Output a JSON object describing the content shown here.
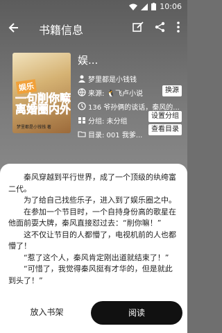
{
  "status": {
    "time": "10:06"
  },
  "appbar": {
    "title": "书籍信息"
  },
  "cover": {
    "tag": "娱乐",
    "title": "一句削你嘛 离婚圈内外",
    "sub": "梦里都是小钱钱 著"
  },
  "book": {
    "name": "娱...",
    "author": "梦里都是小钱钱",
    "source": "来源: 🐧飞卢小说",
    "summary": "136 爷孙俩的谈话，秦风的...",
    "group": "分组: 未分组",
    "toc": "目录: 001 我爹..."
  },
  "chips": {
    "switch_source": "换源",
    "set_group": "设置分组",
    "view_toc": "查看目录"
  },
  "intro": [
    "秦风穿越到平行世界，成了一个顶级的纨绔富二代。",
    "为了给自己找些乐子，进入到了娱乐圈之中。",
    "在参加一个节目时，一个自持身份高的歌星在他面前耍大牌，秦风直接怼过去：“削你嘛！”",
    "这不仅让节目的人都懵了，电视机前的人也都懵了！",
    "“惹了这个人，秦风肯定刚出道就结束了！”",
    "“可惜了，我觉得秦风挺有才华的，但是就此到头了！”"
  ],
  "buttons": {
    "shelf": "放入书架",
    "read": "阅读"
  }
}
